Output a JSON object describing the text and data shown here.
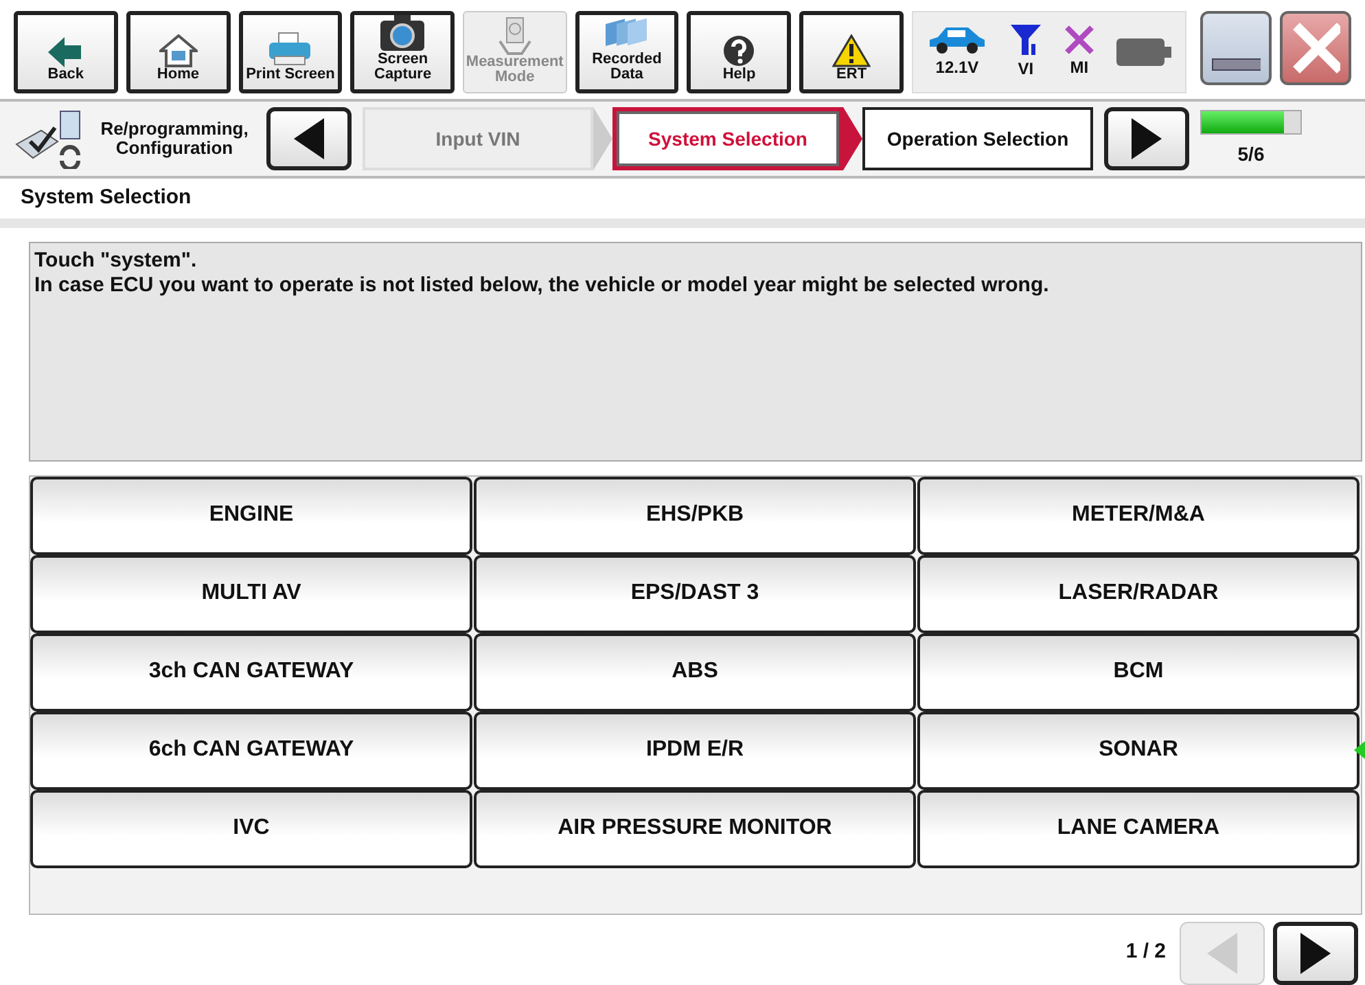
{
  "toolbar": [
    {
      "label": "Back",
      "kind": "back",
      "disabled": false
    },
    {
      "label": "Home",
      "kind": "home",
      "disabled": false
    },
    {
      "label": "Print Screen",
      "kind": "printer",
      "disabled": false
    },
    {
      "label": "Screen Capture",
      "kind": "camera",
      "disabled": false
    },
    {
      "label": "Measurement Mode",
      "kind": "meter",
      "disabled": true
    },
    {
      "label": "Recorded Data",
      "kind": "folders",
      "disabled": false
    },
    {
      "label": "Help",
      "kind": "help",
      "disabled": false
    },
    {
      "label": "ERT",
      "kind": "warning",
      "disabled": false
    }
  ],
  "status": [
    {
      "label": "12.1V",
      "kind": "car"
    },
    {
      "label": "VI",
      "kind": "antenna"
    },
    {
      "label": "MI",
      "kind": "cross"
    },
    {
      "kind": "battery"
    }
  ],
  "breadcrumb": {
    "mode": "Re/programming, Configuration",
    "steps": [
      {
        "label": "Input VIN",
        "selected": false
      },
      {
        "label": "System Selection",
        "selected": true
      },
      {
        "label": "Operation Selection",
        "selected": false
      }
    ],
    "progress": {
      "level": 0.83,
      "reading": "5/6"
    }
  },
  "section_title": "System Selection",
  "message": [
    "Touch \"system\".",
    "In case ECU you want to operate is not listed below, the vehicle or model year might be selected wrong."
  ],
  "systems": [
    {
      "label": "ENGINE"
    },
    {
      "label": "EHS/PKB"
    },
    {
      "label": "METER/M&A"
    },
    {
      "label": "MULTI AV"
    },
    {
      "label": "EPS/DAST 3"
    },
    {
      "label": "LASER/RADAR"
    },
    {
      "label": "3ch CAN GATEWAY"
    },
    {
      "label": "ABS"
    },
    {
      "label": "BCM"
    },
    {
      "label": "6ch CAN GATEWAY"
    },
    {
      "label": "IPDM E/R"
    },
    {
      "label": "SONAR",
      "pointer": true
    },
    {
      "label": "IVC"
    },
    {
      "label": "AIR PRESSURE MONITOR"
    },
    {
      "label": "LANE CAMERA"
    }
  ],
  "pagination": {
    "page": "1 / 2",
    "prev_disabled": true,
    "next_disabled": false
  }
}
